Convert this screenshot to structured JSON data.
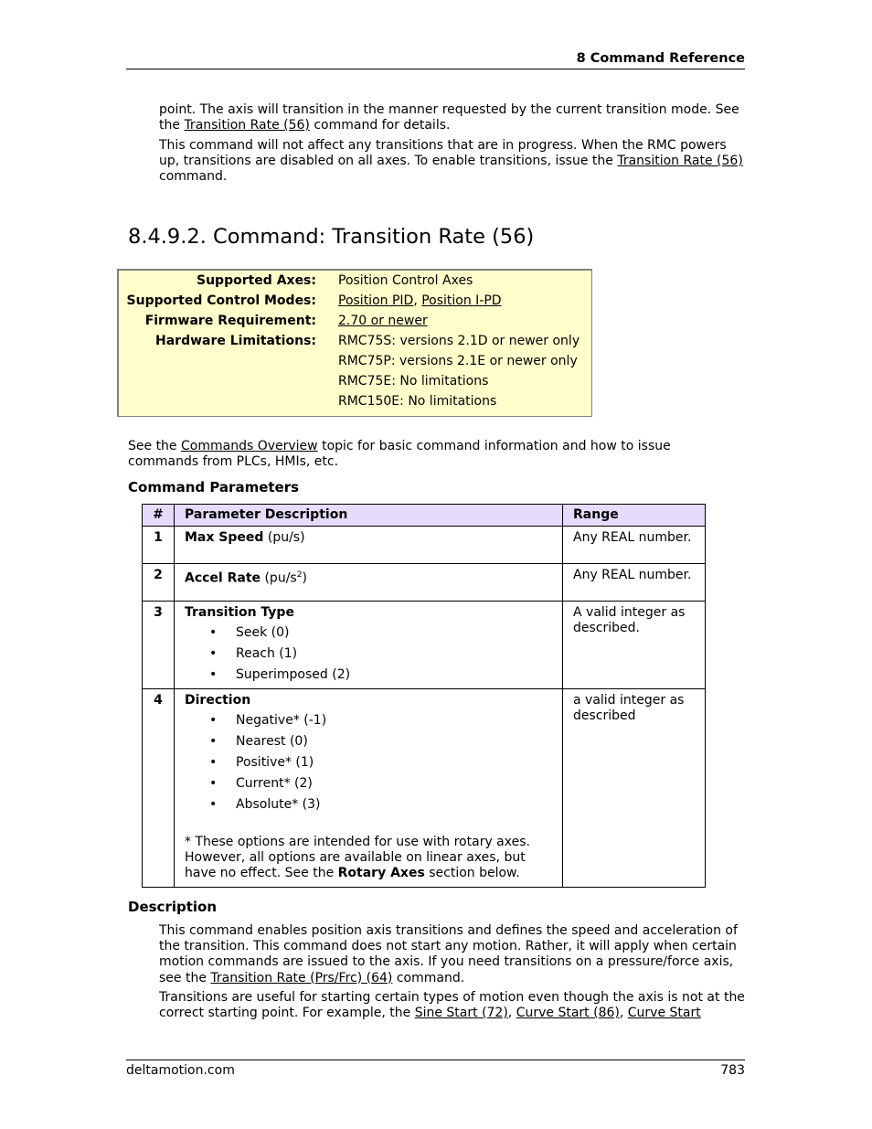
{
  "header": {
    "chapter": "8  Command Reference"
  },
  "intro": {
    "p1_text": "point. The axis will transition in the manner requested by the current transition mode. See the ",
    "p1_link": "Transition Rate (56)",
    "p1_end": " command for details.",
    "p2_text": "This command will not affect any transitions that are in progress. When the RMC powers up, transitions are disabled on all axes. To enable transitions, issue the ",
    "p2_link": "Transition Rate (56)",
    "p2_end": " command."
  },
  "section_title": "8.4.9.2. Command: Transition Rate (56)",
  "infobox": {
    "rows": [
      {
        "label": "Supported Axes:",
        "value": "Position Control Axes"
      },
      {
        "label": "Supported Control Modes:",
        "links": [
          "Position PID",
          "Position I-PD"
        ],
        "separator": ", "
      },
      {
        "label": "Firmware Requirement:",
        "link": "2.70 or newer"
      },
      {
        "label": "Hardware Limitations:",
        "values": [
          "RMC75S: versions 2.1D or newer only",
          "RMC75P: versions 2.1E or newer only",
          "RMC75E: No limitations",
          "RMC150E: No limitations"
        ]
      }
    ],
    "bg_color": "#ffffcc"
  },
  "overview": {
    "text": "See the ",
    "link": "Commands Overview",
    "end": " topic for basic command information and how to issue commands from PLCs, HMIs, etc."
  },
  "params_heading": "Command Parameters",
  "params_table": {
    "header_color": "#e5dcfc",
    "columns": [
      "#",
      "Parameter Description",
      "Range"
    ],
    "rows": [
      {
        "num": "1",
        "name": "Max Speed",
        "unit": " (pu/s)",
        "range": "Any REAL number."
      },
      {
        "num": "2",
        "name": "Accel Rate",
        "unit_pre": " (pu/s",
        "unit_sup": "2",
        "unit_post": ")",
        "range": "Any REAL number."
      },
      {
        "num": "3",
        "name": "Transition Type",
        "options": [
          "Seek (0)",
          "Reach (1)",
          "Superimposed (2)"
        ],
        "range": "A valid integer as described."
      },
      {
        "num": "4",
        "name": "Direction",
        "options": [
          "Negative* (-1)",
          "Nearest (0)",
          "Positive* (1)",
          "Current* (2)",
          "Absolute* (3)"
        ],
        "note_pre": "* These options are intended for use with rotary axes. However, all options are available on linear axes, but have no effect. See the ",
        "note_bold": "Rotary Axes",
        "note_post": " section below.",
        "range": "a valid integer as described"
      }
    ]
  },
  "description": {
    "heading": "Description",
    "p1_text": "This command enables position axis transitions and defines the speed and acceleration of the transition. This command does not start any motion. Rather, it will apply when certain motion commands are issued to the axis. If you need transitions on a pressure/force axis, see the ",
    "p1_link": "Transition Rate (Prs/Frc) (64)",
    "p1_end": " command.",
    "p2_text": "Transitions are useful for starting certain types of motion even though the axis is not at the correct starting point. For example, the ",
    "p2_link1": "Sine Start (72)",
    "p2_sep1": ", ",
    "p2_link2": "Curve Start (86)",
    "p2_sep2": ", ",
    "p2_link3": "Curve Start"
  },
  "footer": {
    "site": "deltamotion.com",
    "page": "783"
  }
}
